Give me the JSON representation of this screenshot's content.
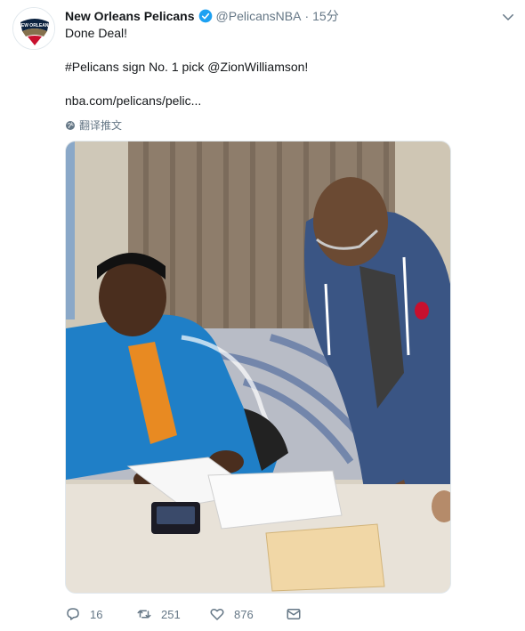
{
  "tweet": {
    "author_name": "New Orleans Pelicans",
    "handle": "@PelicansNBA",
    "separator": "·",
    "time": "15分",
    "text_line_1": "Done Deal!",
    "text_line_2": "#Pelicans sign No. 1 pick @ZionWilliamson!",
    "link_text": "nba.com/pelicans/pelic...",
    "translate_label": "翻译推文",
    "logo_text": "NEW ORLEANS"
  },
  "actions": {
    "reply_count": "16",
    "retweet_count": "251",
    "like_count": "876"
  },
  "icons": {
    "avatar": "pelicans-logo-icon",
    "verified": "verified-badge-icon",
    "caret": "chevron-down-icon",
    "translate": "globe-icon",
    "reply": "reply-icon",
    "retweet": "retweet-icon",
    "like": "heart-icon",
    "message": "envelope-icon"
  },
  "colors": {
    "verified_blue": "#1da1f2",
    "muted_text": "#657786",
    "logo_navy": "#0c2340",
    "logo_red": "#c8102e",
    "logo_gold": "#85714d"
  }
}
